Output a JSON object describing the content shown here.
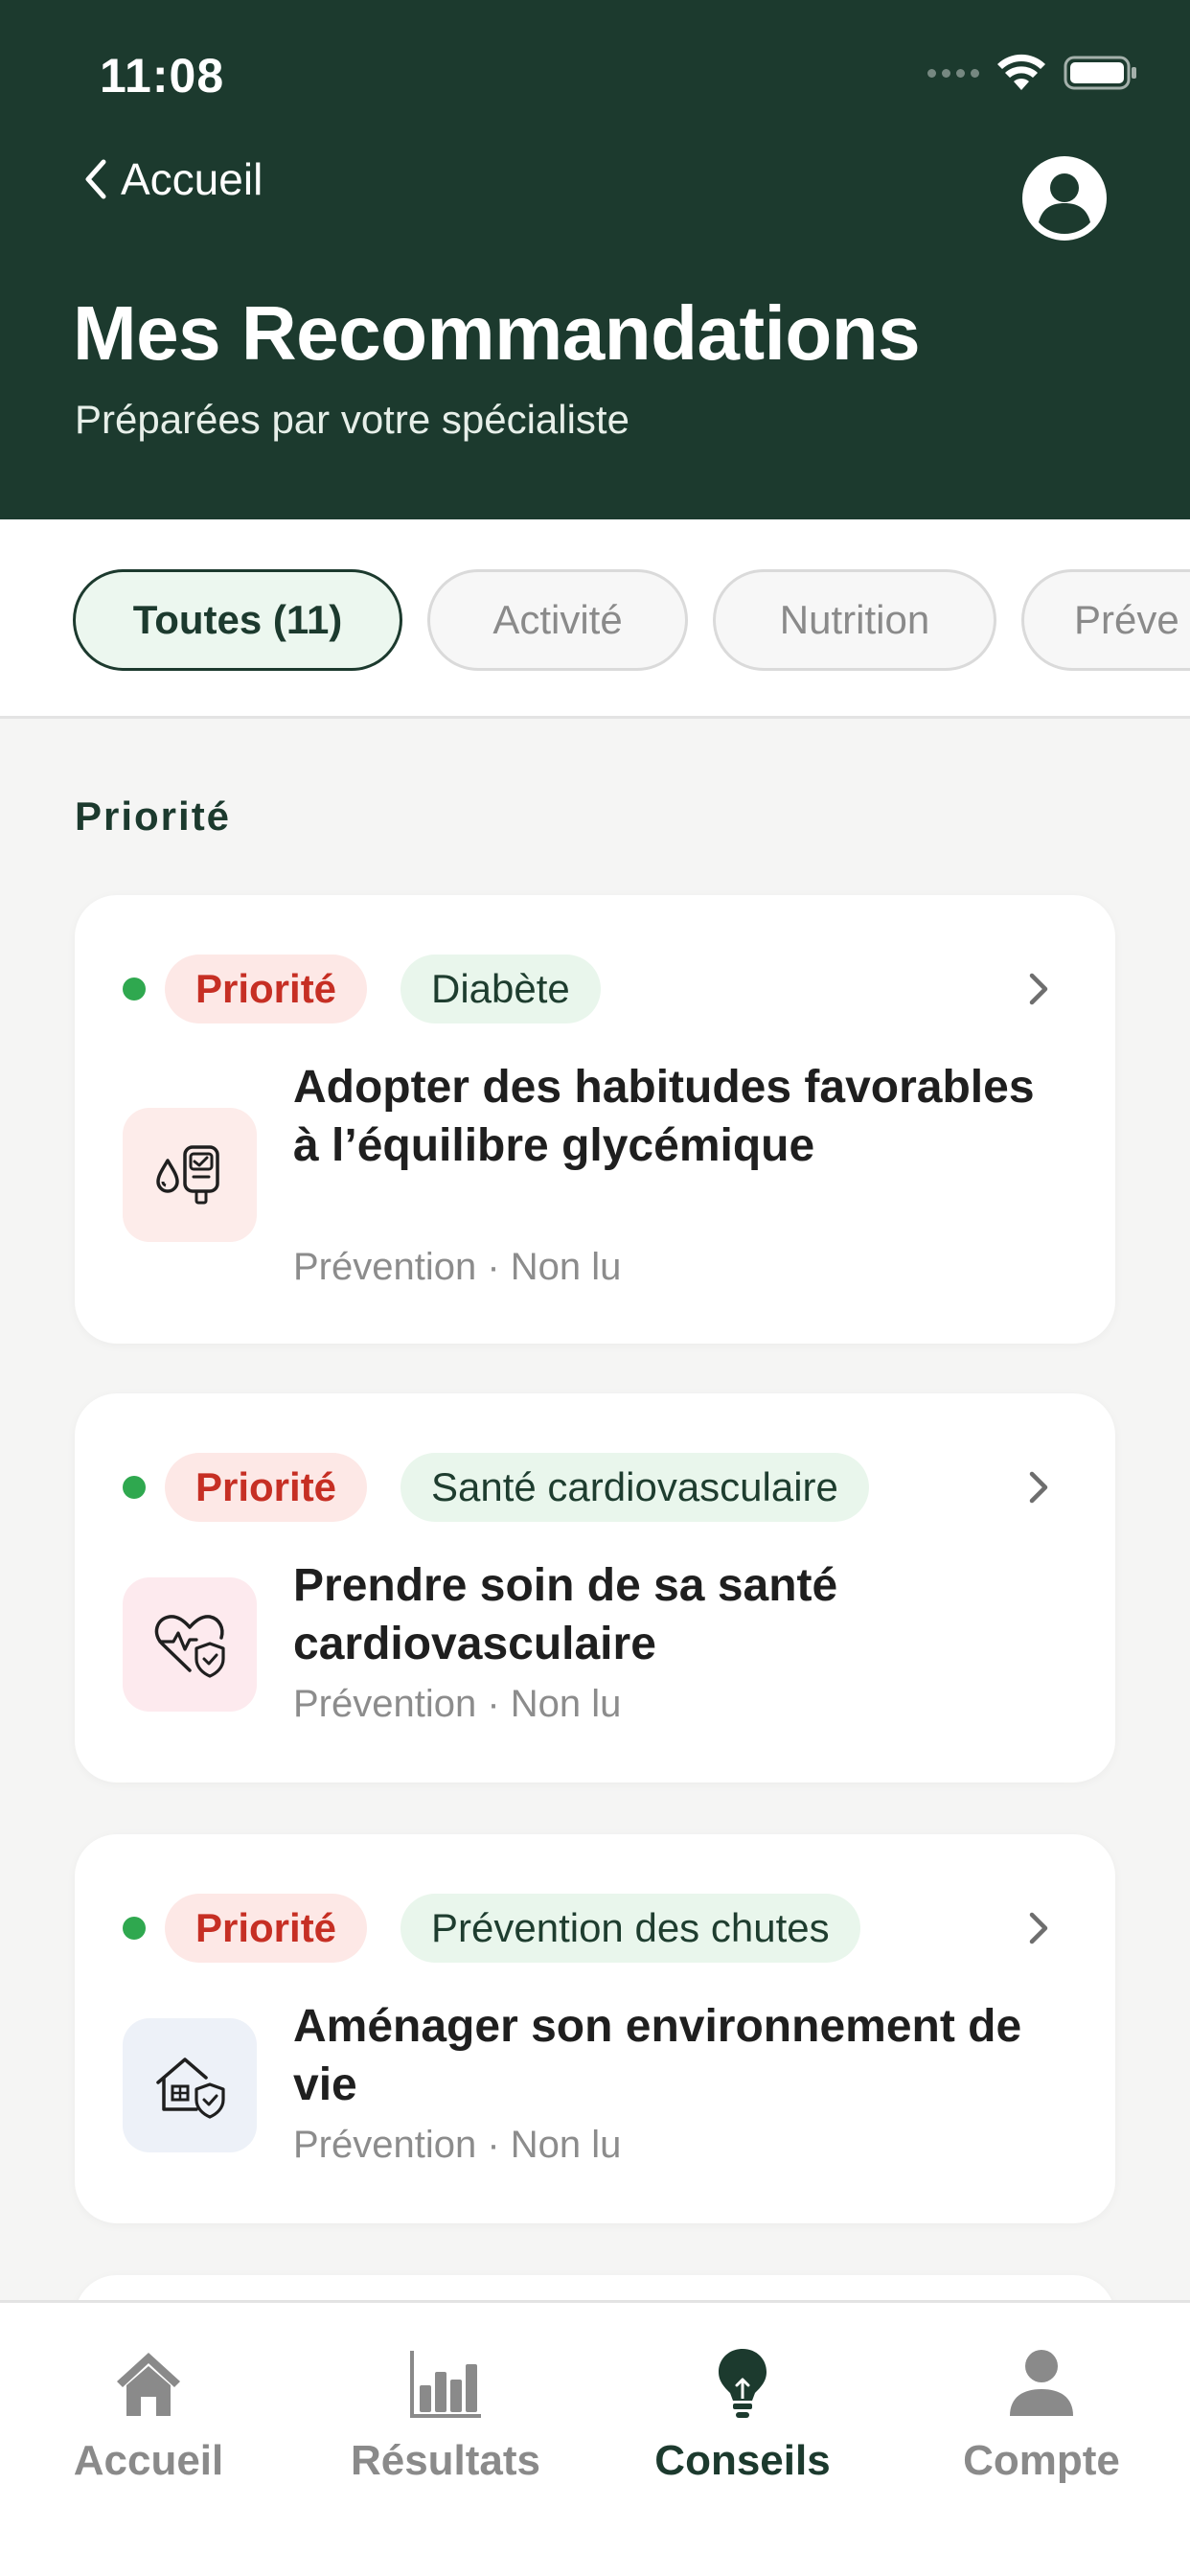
{
  "status_bar": {
    "time": "11:08"
  },
  "header": {
    "back_label": "Accueil",
    "title": "Mes Recommandations",
    "subtitle": "Préparées par votre spécialiste"
  },
  "filters": [
    {
      "label": "Toutes (11)",
      "active": true
    },
    {
      "label": "Activité",
      "active": false
    },
    {
      "label": "Nutrition",
      "active": false
    },
    {
      "label": "Préve",
      "active": false
    }
  ],
  "section": {
    "title": "Priorité"
  },
  "cards": [
    {
      "priority_label": "Priorité",
      "topic_label": "Diabète",
      "title": "Adopter des habitudes favorables à l’équilibre glycémique",
      "meta": "Prévention · Non lu",
      "icon": "glucose-meter-icon"
    },
    {
      "priority_label": "Priorité",
      "topic_label": "Santé cardiovasculaire",
      "title": "Prendre soin de sa santé cardiovasculaire",
      "meta": "Prévention · Non lu",
      "icon": "heart-shield-icon"
    },
    {
      "priority_label": "Priorité",
      "topic_label": "Prévention des chutes",
      "title": "Aménager son environnement de vie",
      "meta": "Prévention · Non lu",
      "icon": "house-shield-icon"
    }
  ],
  "bottom_nav": [
    {
      "label": "Accueil",
      "icon": "home-icon",
      "active": false
    },
    {
      "label": "Résultats",
      "icon": "bar-chart-icon",
      "active": false
    },
    {
      "label": "Conseils",
      "icon": "lightbulb-icon",
      "active": true
    },
    {
      "label": "Compte",
      "icon": "person-icon",
      "active": false
    }
  ],
  "colors": {
    "header_bg": "#1c3a2e",
    "priority_red": "#c62f24",
    "status_dot_green": "#2fa84f",
    "active_chip_bg": "#ecf7ef"
  }
}
